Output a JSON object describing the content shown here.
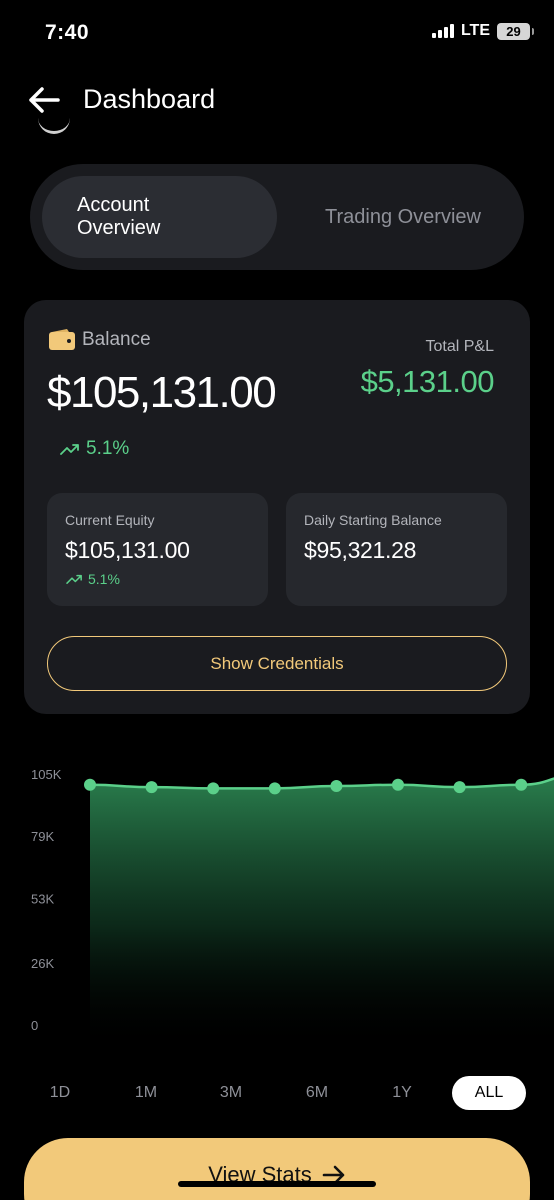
{
  "status_bar": {
    "time": "7:40",
    "network": "LTE",
    "battery": "29"
  },
  "header": {
    "title": "Dashboard",
    "back_icon": "arrow-left-icon"
  },
  "tabs": [
    {
      "label": "Account Overview",
      "active": true
    },
    {
      "label": "Trading Overview",
      "active": false
    }
  ],
  "balance_card": {
    "label": "Balance",
    "value": "$105,131.00",
    "change": "5.1%",
    "pnl_label": "Total P&L",
    "pnl_value": "$5,131.00",
    "equity": {
      "label": "Current Equity",
      "value": "$105,131.00",
      "change": "5.1%"
    },
    "daily_start": {
      "label": "Daily Starting Balance",
      "value": "$95,321.28"
    },
    "credentials_label": "Show Credentials"
  },
  "colors": {
    "accent": "#f2c97a",
    "positive": "#5bd08a",
    "card": "#1a1b1f",
    "background": "#000000"
  },
  "chart_data": {
    "type": "area",
    "y_ticks": [
      "105K",
      "79K",
      "53K",
      "26K",
      "0"
    ],
    "y_tick_values": [
      105000,
      79000,
      53000,
      26000,
      0
    ],
    "ylim": [
      0,
      105000
    ],
    "x": [
      1,
      2,
      3,
      4,
      5,
      6,
      7,
      8,
      9
    ],
    "values": [
      100500,
      99500,
      99000,
      99000,
      100000,
      100500,
      99500,
      100500,
      105131
    ],
    "marked_points": 8,
    "grid": false
  },
  "ranges": [
    {
      "label": "1D",
      "active": false
    },
    {
      "label": "1M",
      "active": false
    },
    {
      "label": "3M",
      "active": false
    },
    {
      "label": "6M",
      "active": false
    },
    {
      "label": "1Y",
      "active": false
    },
    {
      "label": "ALL",
      "active": true
    }
  ],
  "footer": {
    "view_stats_label": "View Stats"
  }
}
